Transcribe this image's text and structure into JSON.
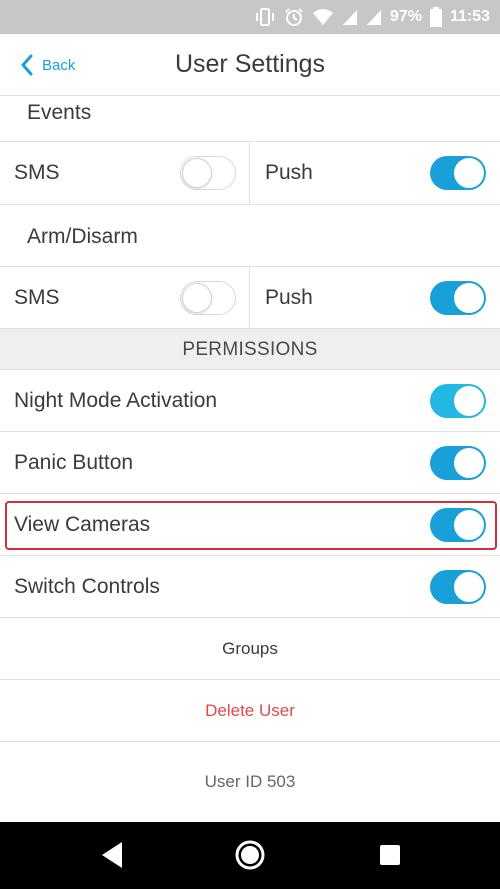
{
  "status_bar": {
    "battery": "97%",
    "time": "11:53"
  },
  "header": {
    "back_label": "Back",
    "title": "User Settings"
  },
  "events": {
    "label": "Events",
    "sms": {
      "label": "SMS",
      "on": false
    },
    "push": {
      "label": "Push",
      "on": true
    }
  },
  "arm_disarm": {
    "label": "Arm/Disarm",
    "sms": {
      "label": "SMS",
      "on": false
    },
    "push": {
      "label": "Push",
      "on": true
    }
  },
  "permissions": {
    "header": "PERMISSIONS",
    "items": [
      {
        "label": "Night Mode Activation",
        "on": true
      },
      {
        "label": "Panic Button",
        "on": true
      },
      {
        "label": "View Cameras",
        "on": true
      },
      {
        "label": "Switch Controls",
        "on": true
      }
    ]
  },
  "actions": {
    "groups": "Groups",
    "delete_user": "Delete User",
    "user_id": "User ID 503"
  },
  "colors": {
    "accent": "#1aa0d8",
    "delete": "#e24a4a",
    "highlight": "#d0303a"
  }
}
